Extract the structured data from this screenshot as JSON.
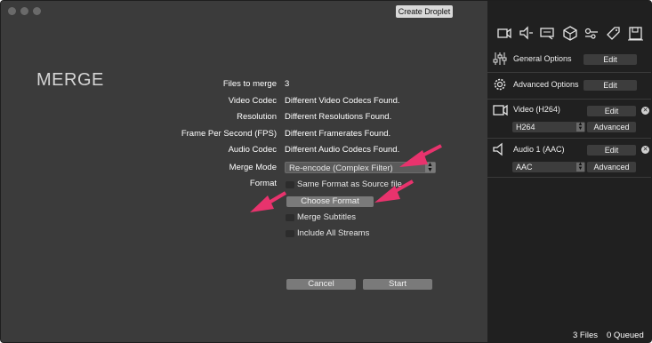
{
  "window": {
    "create_droplet": "Create Droplet",
    "heading": "MERGE"
  },
  "info": {
    "files_to_merge_label": "Files to merge",
    "files_to_merge_value": "3",
    "video_codec_label": "Video Codec",
    "video_codec_value": "Different Video Codecs Found.",
    "resolution_label": "Resolution",
    "resolution_value": "Different Resolutions Found.",
    "fps_label": "Frame Per Second (FPS)",
    "fps_value": "Different Framerates Found.",
    "audio_codec_label": "Audio Codec",
    "audio_codec_value": "Different Audio Codecs Found."
  },
  "merge_mode": {
    "label": "Merge Mode",
    "selected": "Re-encode (Complex Filter)"
  },
  "format": {
    "label": "Format",
    "same_format_label": "Same Format as Source file",
    "choose_format_button": "Choose Format"
  },
  "options": {
    "merge_subtitles": "Merge Subtitles",
    "include_all_streams": "Include All Streams"
  },
  "buttons": {
    "cancel": "Cancel",
    "start": "Start"
  },
  "sidebar": {
    "toolbar_icons": [
      "video-camera-icon",
      "audio-speaker-icon",
      "subtitle-icon",
      "3d-box-icon",
      "metadata-tags-icon",
      "tag-icon",
      "save-icon"
    ],
    "general_options": {
      "label": "General Options",
      "button": "Edit"
    },
    "advanced_options": {
      "label": "Advanced Options",
      "button": "Edit"
    },
    "video": {
      "label": "Video (H264)",
      "edit": "Edit",
      "codec": "H264",
      "advanced": "Advanced"
    },
    "audio": {
      "label": "Audio 1 (AAC)",
      "edit": "Edit",
      "codec": "AAC",
      "advanced": "Advanced"
    }
  },
  "status": {
    "files": "3 Files",
    "queued": "0 Queued"
  },
  "colors": {
    "window_bg": "#3b3b3b",
    "sidebar_bg": "#202020",
    "annotation_arrow": "#e8336d"
  }
}
